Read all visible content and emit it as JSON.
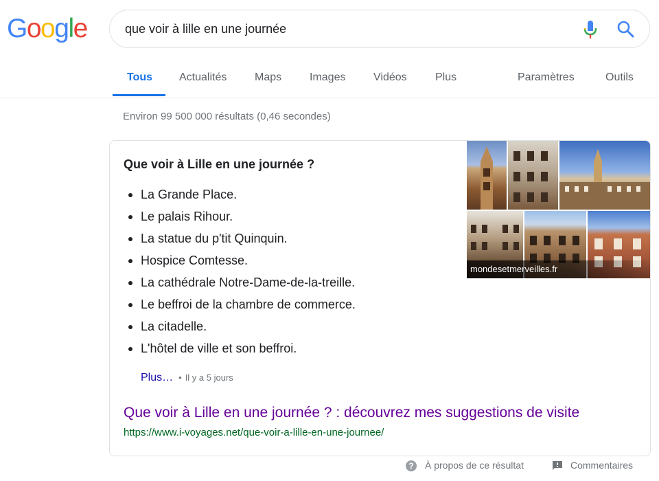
{
  "logo": {
    "letters": [
      "G",
      "o",
      "o",
      "g",
      "l",
      "e"
    ],
    "colors": [
      "#4285f4",
      "#ea4335",
      "#fbbc05",
      "#4285f4",
      "#34a853",
      "#ea4335"
    ]
  },
  "search": {
    "query": "que voir à lille en une journée",
    "icons": [
      "mic-icon",
      "search-icon"
    ]
  },
  "tabs": {
    "items": [
      "Tous",
      "Actualités",
      "Maps",
      "Images",
      "Vidéos",
      "Plus",
      "Paramètres",
      "Outils"
    ],
    "active": "Tous",
    "accent": "#1a73e8"
  },
  "stats": "Environ 99 500 000 résultats (0,46 secondes)",
  "snippet": {
    "title": "Que voir à Lille en une journée ?",
    "items": [
      "La Grande Place.",
      "Le palais Rihour.",
      "La statue du p'tit Quinquin.",
      "Hospice Comtesse.",
      "La cathédrale Notre-Dame-de-la-treille.",
      "Le beffroi de la chambre de commerce.",
      "La citadelle.",
      "L'hôtel de ville et son beffroi."
    ],
    "more_label": "Plus…",
    "separator": "•",
    "date": "Il y a 5 jours",
    "image_source": "mondesetmerveilles.fr",
    "result_title": "Que voir à Lille en une journée ? : découvrez mes suggestions de visite",
    "result_url": "https://www.i-voyages.net/que-voir-a-lille-en-une-journee/",
    "colors": {
      "visited_link": "#660099",
      "url": "#006621",
      "link": "#1a0dab"
    }
  },
  "footer": {
    "about_label": "À propos de ce résultat",
    "feedback_label": "Commentaires",
    "icons": [
      "help-icon",
      "feedback-icon"
    ]
  }
}
